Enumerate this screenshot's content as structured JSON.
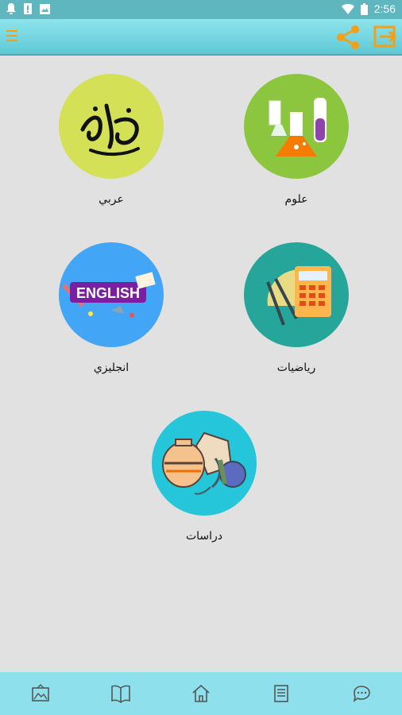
{
  "status_bar": {
    "time": "2:56",
    "icons": [
      "notification-bell-icon",
      "sim-alert-icon",
      "image-icon",
      "wifi-icon",
      "battery-icon"
    ]
  },
  "app_bar": {
    "icons": [
      "menu-icon",
      "share-icon",
      "exit-icon"
    ],
    "accent_color": "#f2a01a",
    "background_color": "#6fd3dd"
  },
  "subjects": [
    {
      "label": "علوم",
      "icon": "science-flasks-icon",
      "color": "#8cc63f"
    },
    {
      "label": "عربي",
      "icon": "arabic-calligraphy-icon",
      "color": "#d4e157"
    },
    {
      "label": "رياضيات",
      "icon": "math-tools-icon",
      "color": "#26a69a"
    },
    {
      "label": "انجليزي",
      "icon": "english-icon",
      "color": "#42a5f5"
    },
    {
      "label": "دراسات",
      "icon": "social-studies-icon",
      "color": "#26c6da"
    }
  ],
  "bottom_nav": {
    "icons": [
      "gallery-icon",
      "book-icon",
      "home-icon",
      "notes-icon",
      "chat-icon"
    ],
    "background_color": "#8ee1ec"
  }
}
